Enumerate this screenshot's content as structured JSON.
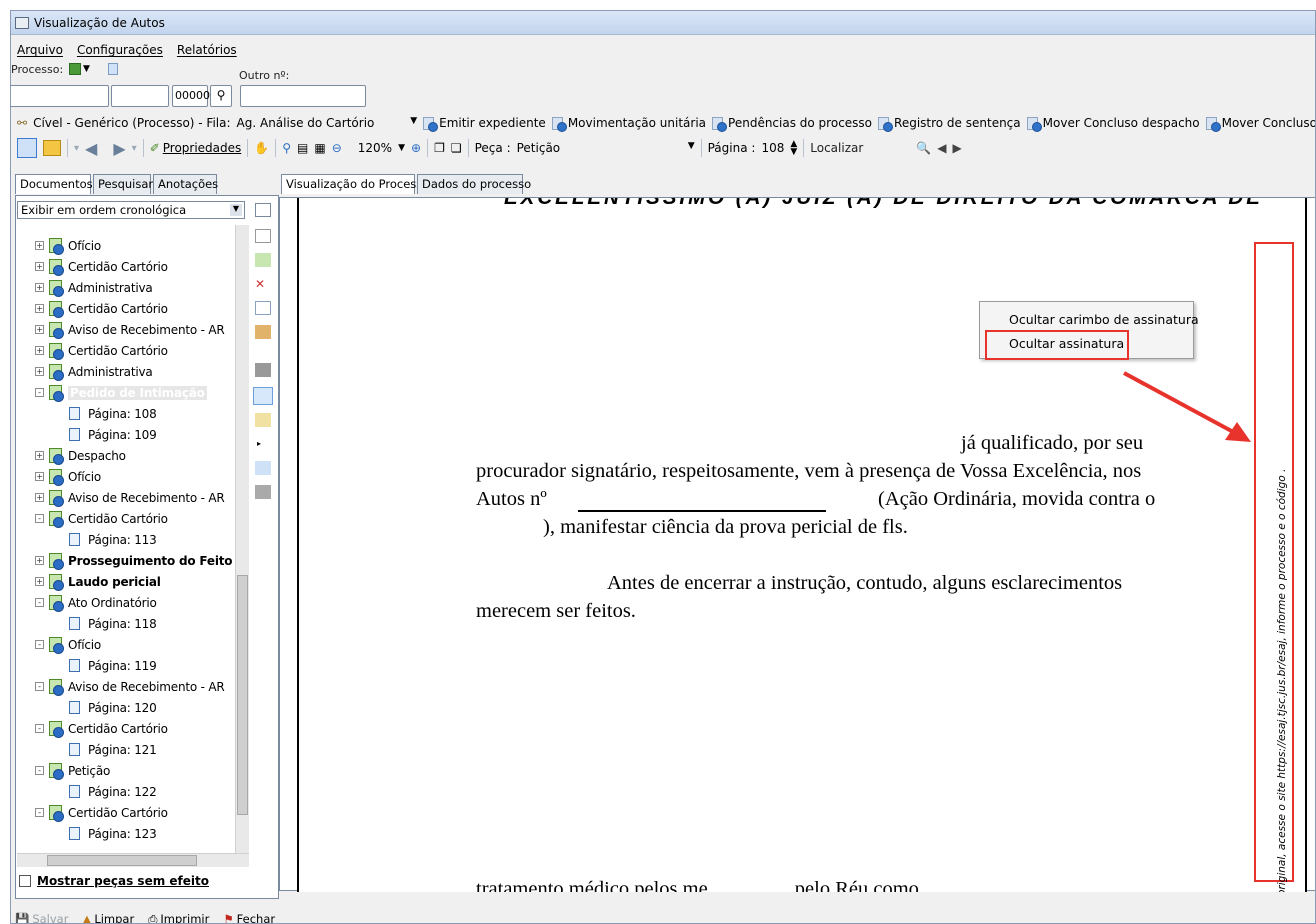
{
  "window": {
    "title": "Visualização de Autos"
  },
  "menu": [
    "Arquivo",
    "Configurações",
    "Relatórios"
  ],
  "process": {
    "label": "Processo:",
    "other_label": "Outro nº:",
    "number_suffix": "00000",
    "field1": "",
    "field2": "",
    "other_value": ""
  },
  "queue": {
    "text": "Cível - Genérico (Processo) - Fila:",
    "value": "Ag. Análise do Cartório"
  },
  "actions": [
    "Emitir expediente",
    "Movimentação unitária",
    "Pendências do processo",
    "Registro de sentença",
    "Mover Concluso despacho",
    "Mover Concluso"
  ],
  "toolbar": {
    "properties": "Propriedades",
    "zoom": "120%",
    "piece_label": "Peça :",
    "piece_value": "Petição",
    "page_label": "Página :",
    "page_value": "108",
    "find_placeholder": "Localizar"
  },
  "left_tabs": [
    "Documentos",
    "Pesquisar",
    "Anotações"
  ],
  "view_tabs": [
    "Visualização do Processo",
    "Dados do processo"
  ],
  "order_select": "Exibir em ordem cronológica",
  "tree": [
    {
      "type": "doc",
      "label": "Ofício",
      "expand": "+"
    },
    {
      "type": "doc",
      "label": "Certidão Cartório",
      "expand": "+"
    },
    {
      "type": "doc",
      "label": "Administrativa",
      "expand": "+"
    },
    {
      "type": "doc",
      "label": "Certidão Cartório",
      "expand": "+"
    },
    {
      "type": "doc",
      "label": "Aviso de Recebimento - AR",
      "expand": "+"
    },
    {
      "type": "doc",
      "label": "Certidão Cartório",
      "expand": "+"
    },
    {
      "type": "doc",
      "label": "Administrativa",
      "expand": "+"
    },
    {
      "type": "doc",
      "label": "Pedido de Intimação",
      "expand": "-",
      "selected": true
    },
    {
      "type": "page",
      "label": "Página: 108"
    },
    {
      "type": "page",
      "label": "Página: 109"
    },
    {
      "type": "doc",
      "label": "Despacho",
      "expand": "+"
    },
    {
      "type": "doc",
      "label": "Ofício",
      "expand": "+"
    },
    {
      "type": "doc",
      "label": "Aviso de Recebimento - AR",
      "expand": "+"
    },
    {
      "type": "doc",
      "label": "Certidão Cartório",
      "expand": "-"
    },
    {
      "type": "page",
      "label": "Página: 113"
    },
    {
      "type": "doc",
      "label": "Prosseguimento do Feito",
      "expand": "+",
      "bold": true
    },
    {
      "type": "doc",
      "label": "Laudo pericial",
      "expand": "+",
      "bold": true
    },
    {
      "type": "doc",
      "label": "Ato Ordinatório",
      "expand": "-"
    },
    {
      "type": "page",
      "label": "Página: 118"
    },
    {
      "type": "doc",
      "label": "Ofício",
      "expand": "-"
    },
    {
      "type": "page",
      "label": "Página: 119"
    },
    {
      "type": "doc",
      "label": "Aviso de Recebimento - AR",
      "expand": "-"
    },
    {
      "type": "page",
      "label": "Página: 120"
    },
    {
      "type": "doc",
      "label": "Certidão Cartório",
      "expand": "-"
    },
    {
      "type": "page",
      "label": "Página: 121"
    },
    {
      "type": "doc",
      "label": "Petição",
      "expand": "-"
    },
    {
      "type": "page",
      "label": "Página: 122"
    },
    {
      "type": "doc",
      "label": "Certidão Cartório",
      "expand": "-"
    },
    {
      "type": "page",
      "label": "Página: 123"
    }
  ],
  "show_no_effect": "Mostrar peças sem efeito",
  "document": {
    "header": "EXCELENTÍSSIMO (A) JUIZ (A) DE DIREITO DA COMARCA DE",
    "line1": "já qualificado, por seu",
    "line2": "procurador signatário, respeitosamente, vem à presença de Vossa Excelência, nos",
    "line3a": "Autos nº",
    "line3b": "(Ação Ordinária, movida contra o",
    "line4": "), manifestar ciência da prova pericial de fls.",
    "line5": "Antes de encerrar a instrução, contudo, alguns esclarecimentos",
    "line6": "merecem ser feitos.",
    "bottom": "tratamento médico pelos me                    ............... pelo Réu como",
    "stamp": "original, acesse o site https://esaj.tjsc.jus.br/esaj, informe o processo                                                                          e o código ."
  },
  "context_menu": [
    "Ocultar carimbo de assinatura",
    "Ocultar assinatura"
  ],
  "bottom": [
    "Salvar",
    "Limpar",
    "Imprimir",
    "Fechar"
  ],
  "colors": {
    "highlight": "#e8332c",
    "tab_bg": "#f0f0f0"
  }
}
